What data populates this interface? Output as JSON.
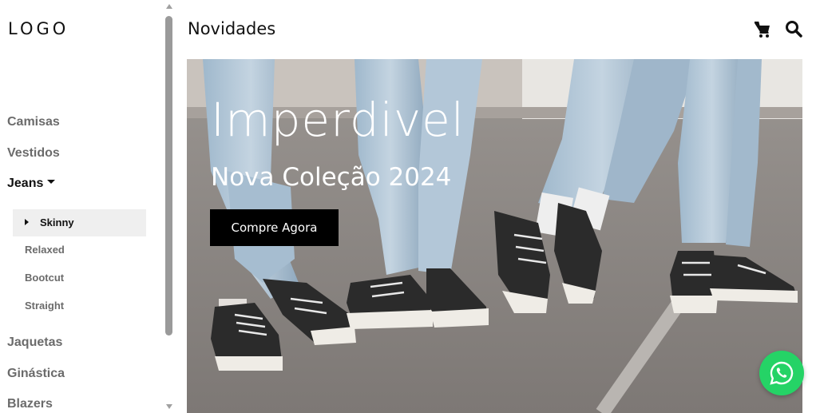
{
  "sidebar": {
    "logo": "LOGO",
    "items": [
      {
        "label": "Camisas"
      },
      {
        "label": "Vestidos"
      },
      {
        "label": "Jeans"
      },
      {
        "label": "Jaquetas"
      },
      {
        "label": "Ginástica"
      },
      {
        "label": "Blazers"
      }
    ],
    "jeans_submenu": [
      {
        "label": "Skinny",
        "selected": true
      },
      {
        "label": "Relaxed"
      },
      {
        "label": "Bootcut"
      },
      {
        "label": "Straight"
      }
    ]
  },
  "header": {
    "title": "Novidades",
    "icons": [
      "cart-icon",
      "search-icon"
    ]
  },
  "hero": {
    "title": "Imperdivel",
    "subtitle": "Nova Coleção 2024",
    "cta_label": "Compre Agora"
  },
  "floating": {
    "icon": "whatsapp-icon",
    "color": "#25d366"
  }
}
